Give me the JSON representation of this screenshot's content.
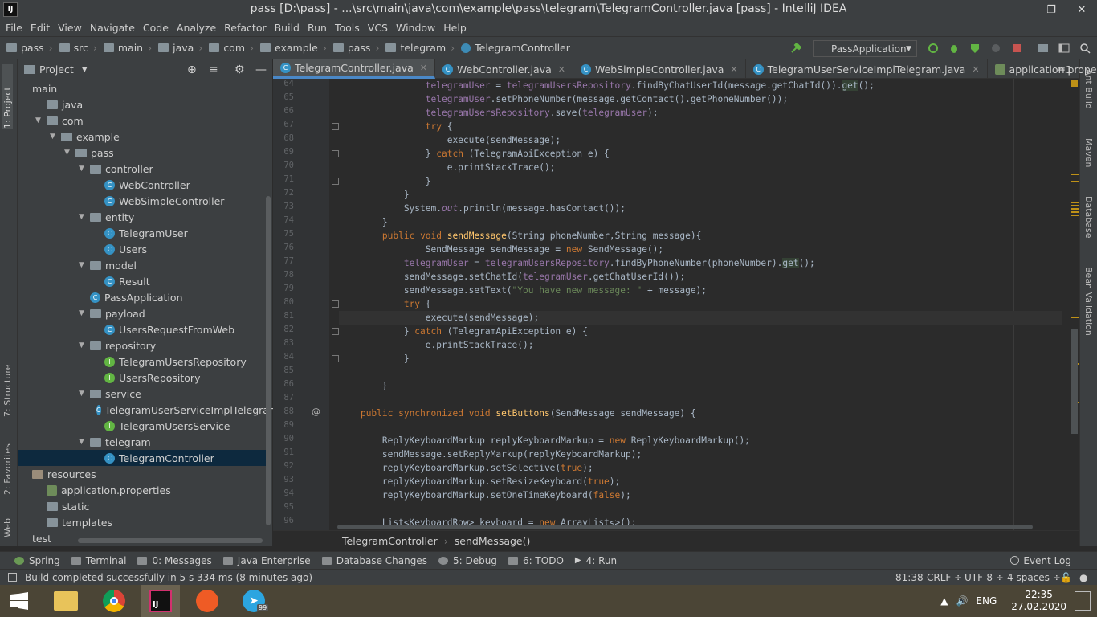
{
  "window": {
    "title": "pass [D:\\pass] - ...\\src\\main\\java\\com\\example\\pass\\telegram\\TelegramController.java [pass] - IntelliJ IDEA",
    "logo": "IJ"
  },
  "menu": [
    "File",
    "Edit",
    "View",
    "Navigate",
    "Code",
    "Analyze",
    "Refactor",
    "Build",
    "Run",
    "Tools",
    "VCS",
    "Window",
    "Help"
  ],
  "breadcrumb": [
    "pass",
    "src",
    "main",
    "java",
    "com",
    "example",
    "pass",
    "telegram",
    "TelegramController"
  ],
  "run_config": "PassApplication",
  "left_tools": {
    "project": "1: Project",
    "structure": "7: Structure",
    "favorites": "2: Favorites",
    "web": "Web"
  },
  "right_tools": [
    "Ant Build",
    "Maven",
    "Database",
    "Bean Validation"
  ],
  "project_panel": {
    "title": "Project"
  },
  "tree": [
    {
      "label": "main",
      "type": "none",
      "indent": 0
    },
    {
      "label": "java",
      "type": "folder",
      "indent": 1
    },
    {
      "label": "com",
      "type": "folder",
      "indent": 1,
      "open": true
    },
    {
      "label": "example",
      "type": "folder",
      "indent": 2,
      "open": true
    },
    {
      "label": "pass",
      "type": "folder",
      "indent": 3,
      "open": true
    },
    {
      "label": "controller",
      "type": "folder",
      "indent": 4,
      "open": true
    },
    {
      "label": "WebController",
      "type": "class",
      "indent": 5
    },
    {
      "label": "WebSimpleController",
      "type": "class",
      "indent": 5
    },
    {
      "label": "entity",
      "type": "folder",
      "indent": 4,
      "open": true
    },
    {
      "label": "TelegramUser",
      "type": "class",
      "indent": 5
    },
    {
      "label": "Users",
      "type": "class",
      "indent": 5
    },
    {
      "label": "model",
      "type": "folder",
      "indent": 4,
      "open": true
    },
    {
      "label": "Result",
      "type": "class",
      "indent": 5
    },
    {
      "label": "PassApplication",
      "type": "class",
      "indent": 4
    },
    {
      "label": "payload",
      "type": "folder",
      "indent": 4,
      "open": true
    },
    {
      "label": "UsersRequestFromWeb",
      "type": "class",
      "indent": 5
    },
    {
      "label": "repository",
      "type": "folder",
      "indent": 4,
      "open": true
    },
    {
      "label": "TelegramUsersRepository",
      "type": "interface",
      "indent": 5
    },
    {
      "label": "UsersRepository",
      "type": "interface",
      "indent": 5
    },
    {
      "label": "service",
      "type": "folder",
      "indent": 4,
      "open": true
    },
    {
      "label": "TelegramUserServiceImplTelegram",
      "type": "class",
      "indent": 5
    },
    {
      "label": "TelegramUsersService",
      "type": "interface",
      "indent": 5
    },
    {
      "label": "telegram",
      "type": "folder",
      "indent": 4,
      "open": true
    },
    {
      "label": "TelegramController",
      "type": "class",
      "indent": 5,
      "selected": true
    },
    {
      "label": "resources",
      "type": "resfolder",
      "indent": 0
    },
    {
      "label": "application.properties",
      "type": "prop",
      "indent": 1
    },
    {
      "label": "static",
      "type": "folder",
      "indent": 1
    },
    {
      "label": "templates",
      "type": "folder",
      "indent": 1
    },
    {
      "label": "test",
      "type": "none",
      "indent": 0
    }
  ],
  "tabs": [
    {
      "label": "TelegramController.java",
      "active": true
    },
    {
      "label": "WebController.java"
    },
    {
      "label": "WebSimpleController.java"
    },
    {
      "label": "TelegramUserServiceImplTelegram.java"
    },
    {
      "label": "application.properties"
    }
  ],
  "tab_overflow": "≡1",
  "code": [
    {
      "n": "64",
      "t": "                telegramUser = telegramUsersRepository.findByChatUserId(message.getChatId()).get();"
    },
    {
      "n": "65",
      "t": "                telegramUser.setPhoneNumber(message.getContact().getPhoneNumber());"
    },
    {
      "n": "66",
      "t": "                telegramUsersRepository.save(telegramUser);"
    },
    {
      "n": "67",
      "t": "                try {"
    },
    {
      "n": "68",
      "t": "                    execute(sendMessage);"
    },
    {
      "n": "69",
      "t": "                } catch (TelegramApiException e) {"
    },
    {
      "n": "70",
      "t": "                    e.printStackTrace();"
    },
    {
      "n": "71",
      "t": "                }"
    },
    {
      "n": "72",
      "t": "            }"
    },
    {
      "n": "73",
      "t": "            System.out.println(message.hasContact());"
    },
    {
      "n": "74",
      "t": "        }"
    },
    {
      "n": "75",
      "t": "        public void sendMessage(String phoneNumber,String message){"
    },
    {
      "n": "76",
      "t": "                SendMessage sendMessage = new SendMessage();"
    },
    {
      "n": "77",
      "t": "            telegramUser = telegramUsersRepository.findByPhoneNumber(phoneNumber).get();"
    },
    {
      "n": "78",
      "t": "            sendMessage.setChatId(telegramUser.getChatUserId());"
    },
    {
      "n": "79",
      "t": "            sendMessage.setText(\"You have new message: \" + message);"
    },
    {
      "n": "80",
      "t": "            try {"
    },
    {
      "n": "81",
      "t": "                execute(sendMessage);"
    },
    {
      "n": "82",
      "t": "            } catch (TelegramApiException e) {"
    },
    {
      "n": "83",
      "t": "                e.printStackTrace();"
    },
    {
      "n": "84",
      "t": "            }"
    },
    {
      "n": "85",
      "t": ""
    },
    {
      "n": "86",
      "t": "        }"
    },
    {
      "n": "87",
      "t": ""
    },
    {
      "n": "88",
      "t": "    public synchronized void setButtons(SendMessage sendMessage) {"
    },
    {
      "n": "89",
      "t": ""
    },
    {
      "n": "90",
      "t": "        ReplyKeyboardMarkup replyKeyboardMarkup = new ReplyKeyboardMarkup();"
    },
    {
      "n": "91",
      "t": "        sendMessage.setReplyMarkup(replyKeyboardMarkup);"
    },
    {
      "n": "92",
      "t": "        replyKeyboardMarkup.setSelective(true);"
    },
    {
      "n": "93",
      "t": "        replyKeyboardMarkup.setResizeKeyboard(true);"
    },
    {
      "n": "94",
      "t": "        replyKeyboardMarkup.setOneTimeKeyboard(false);"
    },
    {
      "n": "95",
      "t": ""
    },
    {
      "n": "96",
      "t": "        List<KeyboardRow> keyboard = new ArrayList<>();"
    }
  ],
  "gutter_marker": "@",
  "editor_breadcrumb": [
    "TelegramController",
    "sendMessage()"
  ],
  "bottom_tools": [
    "Spring",
    "Terminal",
    "0: Messages",
    "Java Enterprise",
    "Database Changes",
    "5: Debug",
    "6: TODO",
    "4: Run"
  ],
  "event_log": "Event Log",
  "status": {
    "message": "Build completed successfully in 5 s 334 ms (8 minutes ago)",
    "position": "81:38",
    "line_sep": "CRLF ÷",
    "encoding": "UTF-8 ÷",
    "indent": "4 spaces ÷"
  },
  "taskbar": {
    "lang": "ENG",
    "time": "22:35",
    "date": "27.02.2020",
    "telegram_badge": "99"
  }
}
